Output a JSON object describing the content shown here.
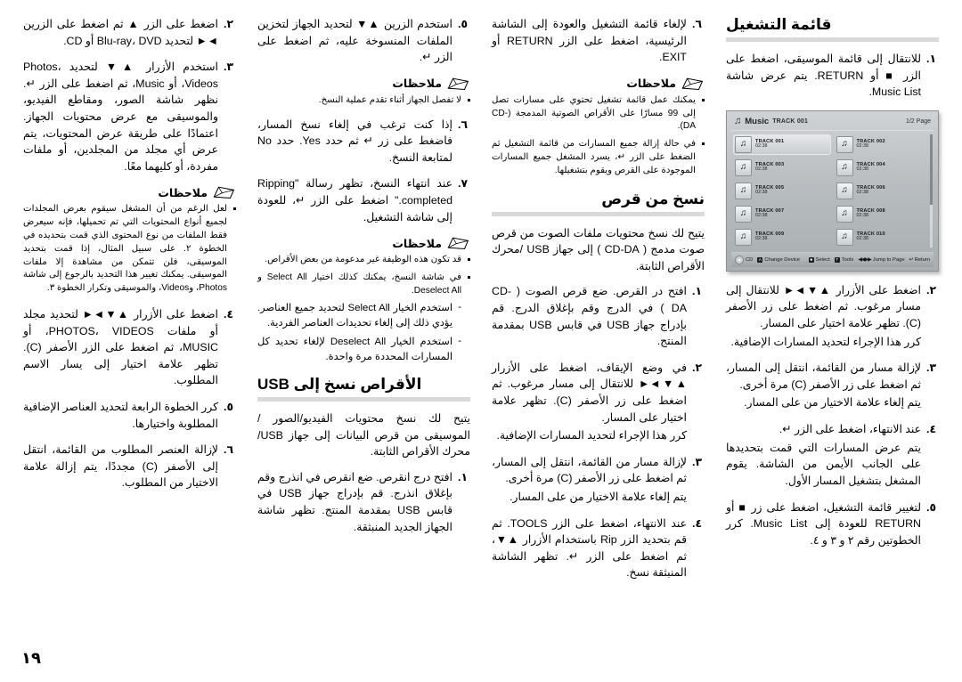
{
  "page": {
    "number": "١٩"
  },
  "columns": [
    {
      "id": "col-playlist",
      "heading": "قائمة التشغيل",
      "screenshot": {
        "title": "Music",
        "track_label": "TRACK 001",
        "page_indicator": "1/2 Page",
        "note_icon": "music-note-icon",
        "tracks": [
          {
            "name": "TRACK 001",
            "time": "02:38",
            "selected": true
          },
          {
            "name": "TRACK 002",
            "time": "02:38",
            "selected": false
          },
          {
            "name": "TRACK 003",
            "time": "02:38",
            "selected": false
          },
          {
            "name": "TRACK 004",
            "time": "02:38",
            "selected": false
          },
          {
            "name": "TRACK 005",
            "time": "02:38",
            "selected": false
          },
          {
            "name": "TRACK 006",
            "time": "02:38",
            "selected": false
          },
          {
            "name": "TRACK 007",
            "time": "02:38",
            "selected": false
          },
          {
            "name": "TRACK 008",
            "time": "02:38",
            "selected": false
          },
          {
            "name": "TRACK 009",
            "time": "02:38",
            "selected": false
          },
          {
            "name": "TRACK 010",
            "time": "02:38",
            "selected": false
          }
        ],
        "footer": {
          "source": "CD",
          "change_device": "Change Device",
          "select": "Select",
          "tools": "Tools",
          "jump_to_page": "Jump to Page",
          "return": "Return"
        }
      },
      "steps": [
        {
          "num": "١.",
          "text": "للانتقال إلى قائمة الموسيقى، اضغط على الزر ■ أو RETURN. يتم عرض شاشة Music List."
        },
        {
          "num": "٢.",
          "text": "اضغط على الأزرار ▲▼◄► للانتقال إلى مسار مرغوب. ثم اضغط على زر الأصفر (C). تظهر علامة اختيار على المسار.",
          "sub": "كرر هذا الإجراء لتحديد المسارات الإضافية."
        },
        {
          "num": "٣.",
          "text": "لإزالة مسار من القائمة، انتقل إلى المسار، ثم اضغط على زر الأصفر (C) مرة أخرى.",
          "sub": "يتم إلغاء علامة الاختيار من على المسار."
        },
        {
          "num": "٤.",
          "text": "عند الانتهاء، اضغط على الزر ↵.",
          "sub": "يتم عرض المسارات التي قمت بتحديدها على الجانب الأيمن من الشاشة. يقوم المشغل بتشغيل المسار الأول."
        },
        {
          "num": "٥.",
          "text": "لتغيير قائمة التشغيل، اضغط على زر ■ أو RETURN للعودة إلى Music List. كرر الخطوتين رقم ٢ و ٣ و ٤."
        }
      ]
    },
    {
      "id": "col-copy-from-disc",
      "top_step": {
        "num": "٦.",
        "text": "لإلغاء قائمة التشغيل والعودة إلى الشاشة الرئيسية، اضغط على الزر RETURN أو EXIT."
      },
      "notes_label": "ملاحظات",
      "notes": [
        "يمكنك عمل قائمة تشغيل تحتوي على مسارات تصل إلى 99 مسارًا على الأقراص الصوتية المدمجة (CD-DA).",
        "في حالة إزالة جميع المسارات من قائمة التشغيل ثم الضغط على الزر ↵، يسرد المشغل جميع المسارات الموجودة على القرص ويقوم بتشغيلها."
      ],
      "heading": "نسخ من قرص",
      "intro": "يتيح لك نسخ محتويات ملفات الصوت من قرص صوت مدمج ( CD-DA ) إلى جهاز USB /محرك الأقراص الثابتة.",
      "steps": [
        {
          "num": "١.",
          "text": "افتح در القرص. ضع قرص الصوت ( CD-DA ) في الدرج وقم بإغلاق الدرج. قم بإدراج جهاز USB في قابس USB بمقدمة المنتج."
        },
        {
          "num": "٢.",
          "text": "في وضع الإيقاف، اضغط على الأزرار ▲▼◄► للانتقال إلى مسار مرغوب. ثم اضغط على زر الأصفر (C). تظهر علامة اختيار على المسار.",
          "sub": "كرر هذا الإجراء لتحديد المسارات الإضافية."
        },
        {
          "num": "٣.",
          "text": "لإزالة مسار من القائمة، انتقل إلى المسار، ثم اضغط على زر الأصفر (C) مرة أخرى.",
          "sub": "يتم إلغاء علامة الاختيار من على المسار."
        },
        {
          "num": "٤.",
          "text": "عند الانتهاء، اضغط على الزر TOOLS. ثم قم بتحديد الزر Rip باستخدام الأزرار ▲▼، ثم اضغط على الزر ↵. تظهر الشاشة المنبثقة نسخ."
        }
      ]
    },
    {
      "id": "col-rip-to-usb",
      "top_steps": [
        {
          "num": "٥.",
          "text": "استخدم الزرين ▲▼ لتحديد الجهاز لتخزين الملفات المنسوخة عليه، ثم اضغط على الزر ↵."
        }
      ],
      "notes_label_1": "ملاحظات",
      "notes_1": [
        "لا تفصل الجهاز أثناء تقدم عملية النسخ."
      ],
      "steps": [
        {
          "num": "٦.",
          "text": "إذا كنت ترغب في إلغاء نسخ المسار، فاضغط على زر ↵ ثم حدد Yes. حدد No لمتابعة النسخ."
        },
        {
          "num": "٧.",
          "text": "عند انتهاء النسخ، تظهر رسالة \"Ripping completed.\" اضغط على الزر ↵، للعودة إلى شاشة التشغيل."
        }
      ],
      "notes_label_2": "ملاحظات",
      "notes_2": [
        "قد تكون هذه الوظيفة غير مدعومة من بعض الأقراص.",
        "في شاشة النسخ، يمكنك كذلك اختيار Select All و Deselect All."
      ],
      "subnotes": [
        "استخدم الخيار Select All لتحديد جميع العناصر. يؤدي ذلك إلى إلغاء تحديدات العناصر الفردية.",
        "استخدم الخيار Deselect All لإلغاء تحديد كل المسارات المحددة مرة واحدة."
      ],
      "heading": "الأقراص نسخ إلى USB",
      "intro": "يتيح لك نسخ محتويات الفيديو/الصور / الموسيقى من قرص البيانات إلى جهاز USB/محرك الأقراص الثابتة.",
      "bottom_steps": [
        {
          "num": "١.",
          "text": "افتح درج انقرص. ضع انقرص في انذرج وقم بإغلاق انذرج. قم بإدراج جهاز USB في قابس USB بمقدمة المنتج. تظهر شاشة الجهاز الجديد المنبثقة."
        }
      ]
    },
    {
      "id": "col-device-steps",
      "steps": [
        {
          "num": "٢.",
          "text": "اضغط على الزر ▲ ثم اضغط على الزرين ◄► لتحديد Blu-ray، DVD أو CD."
        },
        {
          "num": "٣.",
          "text": "استخدم الأزرار ▲▼ لتحديد Photos، Videos، أو Music، ثم اضغط على الزر ↵. نظهر شاشة الصور، ومقاطع الفيديو، والموسيقى مع عرض محتويات الجهاز. اعتمادًا على طريقة عرض المحتويات، يتم عرض أي مجلد من المجلدين، أو ملفات مفردة، أو كليهما معًا."
        }
      ],
      "notes_label": "ملاحظات",
      "notes": [
        "لعل الرغم من أن المشغل سيقوم بعرض المجلدات لجميع أنواع المحتويات التي تم تحميلها، فإنه سيعرض فقط الملفات من نوع المحتوى الذي قمت بتحديده في الخطوة ٢. على سبيل المثال، إذا قمت بتحديد الموسيقى، فلن تتمكن من مشاهدة إلا ملفات الموسيقى. يمكنك تغيير هذا التحديد بالرجوع إلى شاشة Photos، وVideos، والموسيقى وتكرار الخطوة ٣."
      ],
      "steps2": [
        {
          "num": "٤.",
          "text": "اضغط على الأزرار ▲▼◄► لتحديد مجلد أو ملفات PHOTOS، VIDEOS، أو MUSIC، ثم اضغط على الزر الأصفر (C). تظهر علامة اختيار إلى يسار الاسم المطلوب."
        },
        {
          "num": "٥.",
          "text": "كرر الخطوة الرابعة لتحديد العناصر الإضافية المطلوبة واختيارها."
        },
        {
          "num": "٦.",
          "text": "لإزالة العنصر المطلوب من القائمة، انتقل إلى الأصفر (C) مجددًا، يتم إزالة علامة الاختيار من المطلوب."
        }
      ]
    }
  ]
}
